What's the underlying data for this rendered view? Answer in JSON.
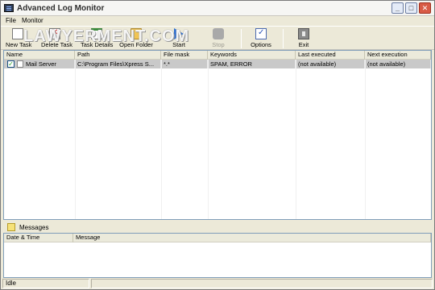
{
  "window": {
    "title": "Advanced Log Monitor"
  },
  "title_buttons": {
    "minimize": "_",
    "maximize": "□",
    "close": "✕"
  },
  "menu": {
    "file": "File",
    "monitor": "Monitor"
  },
  "toolbar": {
    "new_task": "New Task",
    "delete_task": "Delete Task",
    "task_details": "Task Details",
    "open_folder": "Open Folder",
    "start": "Start",
    "stop": "Stop",
    "options": "Options",
    "exit": "Exit"
  },
  "watermark": "LAWYERMENT.COM",
  "tasks_table": {
    "columns": [
      "Name",
      "Path",
      "File mask",
      "Keywords",
      "Last executed",
      "Next execution"
    ],
    "rows": [
      {
        "checked": true,
        "check_glyph": "✓",
        "name": "Mail Server",
        "path": "C:\\Program Files\\Xpress S...",
        "file_mask": "*.*",
        "keywords": "SPAM, ERROR",
        "last_executed": "(not available)",
        "next_execution": "(not available)"
      }
    ]
  },
  "messages": {
    "title": "Messages",
    "columns": [
      "Date & Time",
      "Message"
    ]
  },
  "status": {
    "text": "Idle"
  },
  "colors": {
    "selected_row": "#c9c9c9",
    "grid_border": "#7f9db9",
    "window_bg": "#ece9d8"
  }
}
